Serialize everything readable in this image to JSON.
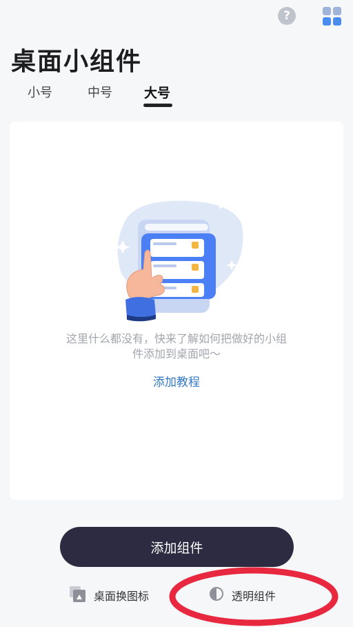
{
  "page": {
    "title": "桌面小组件"
  },
  "tabs": [
    {
      "label": "小号",
      "active": false
    },
    {
      "label": "中号",
      "active": false
    },
    {
      "label": "大号",
      "active": true
    }
  ],
  "empty_state": {
    "message_line1": "这里什么都没有，快来了解如何把做好的小组",
    "message_line2": "件添加到桌面吧～",
    "tutorial_link": "添加教程"
  },
  "actions": {
    "add_widget": "添加组件",
    "change_desktop_icon": "桌面换图标",
    "transparent_widget": "透明组件"
  },
  "icons": {
    "help": "question-mark-icon",
    "grid": "widget-grid-icon"
  },
  "colors": {
    "primary_button": "#2c2b42",
    "link": "#3479c4",
    "accent_blue": "#4a7ff5",
    "annotation_red": "#e8283f"
  }
}
